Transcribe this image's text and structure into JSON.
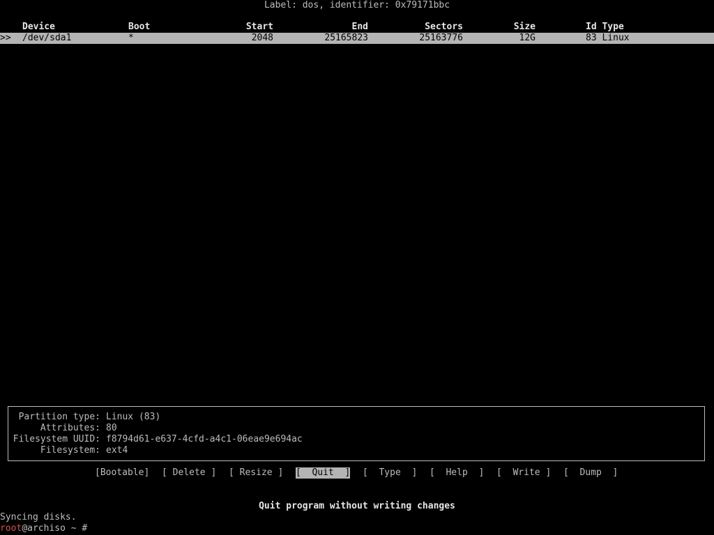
{
  "header": {
    "label": "Label: dos, identifier: 0x79171bbc"
  },
  "table": {
    "columns": {
      "device": "Device",
      "boot": "Boot",
      "start": "Start",
      "end": "End",
      "sectors": "Sectors",
      "size": "Size",
      "id_type": "Id Type"
    },
    "rows": [
      {
        "marker": ">>",
        "device": "/dev/sda1",
        "boot": "*",
        "start": "2048",
        "end": "25165823",
        "sectors": "25163776",
        "size": "12G",
        "id_type": "83 Linux"
      }
    ]
  },
  "info": {
    "partition_type_label": "Partition type:",
    "partition_type_value": "Linux (83)",
    "attributes_label": "Attributes:",
    "attributes_value": "80",
    "fs_uuid_label": "Filesystem UUID:",
    "fs_uuid_value": "f8794d61-e637-4cfd-a4c1-06eae9e694ac",
    "filesystem_label": "Filesystem:",
    "filesystem_value": "ext4"
  },
  "menu": {
    "items": [
      "[Bootable]",
      "[ Delete ]",
      "[ Resize ]",
      "[  Quit  ]",
      "[  Type  ]",
      "[  Help  ]",
      "[  Write ]",
      "[  Dump  ]"
    ],
    "selected": "[  Quit  ]"
  },
  "hint": "Quit program without writing changes",
  "shell": {
    "output": "Syncing disks.",
    "prompt_user": "root",
    "prompt_rest": "@archiso ~ #"
  },
  "colors": {
    "background": "#000000",
    "text": "#bdbdbd",
    "highlight_bg": "#b4b4b4",
    "prompt_user": "#d8504a"
  }
}
